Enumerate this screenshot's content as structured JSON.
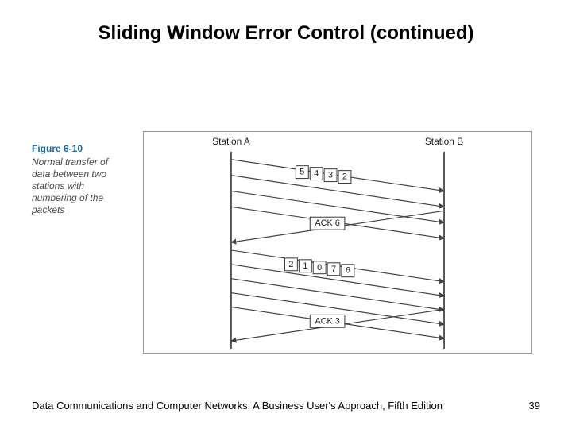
{
  "title": "Sliding Window Error Control (continued)",
  "figure": {
    "number": "Figure 6-10",
    "caption": "Normal transfer of data between two stations with numbering of the packets"
  },
  "diagram": {
    "stationA": "Station A",
    "stationB": "Station B",
    "packets1": [
      "5",
      "4",
      "3",
      "2"
    ],
    "ack1": "ACK 6",
    "packets2": [
      "2",
      "1",
      "0",
      "7",
      "6"
    ],
    "ack2": "ACK 3"
  },
  "footer": {
    "text": "Data Communications and Computer Networks: A Business User's Approach, Fifth Edition",
    "page": "39"
  }
}
